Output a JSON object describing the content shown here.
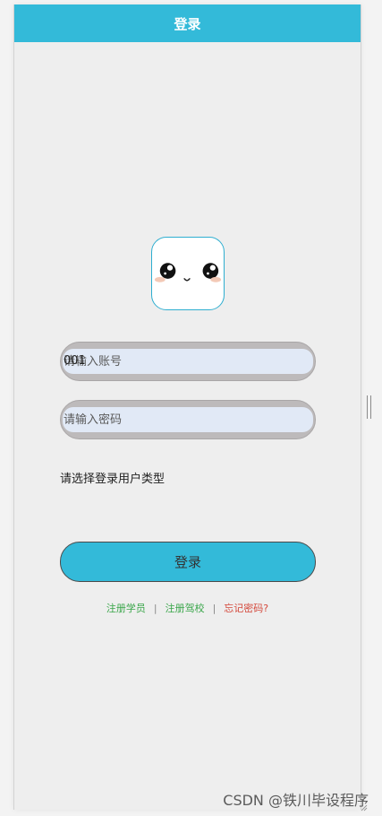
{
  "header": {
    "title": "登录"
  },
  "avatar": {
    "icon": "cute-face-icon"
  },
  "form": {
    "account": {
      "value": "001",
      "placeholder": "请输入账号"
    },
    "password": {
      "placeholder": "请输入密码"
    },
    "user_type_prompt": "请选择登录用户类型",
    "submit_label": "登录"
  },
  "links": {
    "register_student": "注册学员",
    "register_school": "注册驾校",
    "forgot_password": "忘记密码?",
    "separator": "|"
  },
  "watermark": "CSDN @铁川毕设程序",
  "colors": {
    "accent": "#33bad9",
    "link_green": "#3aa64a",
    "link_red": "#d4483b",
    "input_fill": "#e1e9f6"
  }
}
